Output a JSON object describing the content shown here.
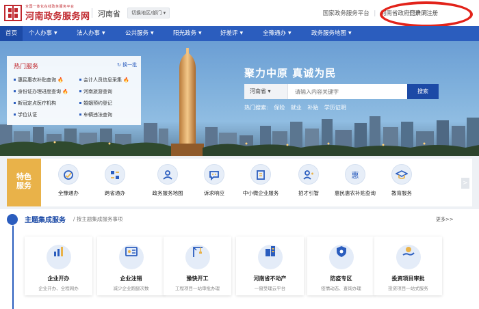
{
  "header": {
    "logo_small": "全国一体化在线政务服务平台",
    "logo_name": "河南政务服务网",
    "province": "河南省",
    "switch_label": "切换地区/部门 ▾",
    "links": [
      "国家政务服务平台",
      "河南省政府门户网"
    ],
    "login": "登录 / 注册"
  },
  "nav": {
    "items": [
      "首页",
      "个人办事",
      "法人办事",
      "公共服务",
      "阳光政务",
      "好差评",
      "全豫通办",
      "政务服务地图"
    ]
  },
  "hot_services": {
    "title": "热门服务",
    "refresh": "↻ 换一批",
    "items": [
      "惠民惠农补贴查询",
      "会计人员信息采集",
      "身份证办理进度查询",
      "河南旅游查询",
      "新冠定点医疗机构",
      "婚姻预约登记",
      "学位认证",
      "车辆违法查询"
    ]
  },
  "hero": {
    "slogan": "聚力中原  真诚为民",
    "search_province": "河南省 ▾",
    "search_placeholder": "请输入内容关键字",
    "search_button": "搜索",
    "hot_search_label": "热门搜索:",
    "hot_keywords": [
      "保险",
      "就业",
      "补贴",
      "学历证明"
    ]
  },
  "featured": {
    "tag_line1": "特色",
    "tag_line2": "服务",
    "items": [
      "全豫通办",
      "跨省通办",
      "政务服务地图",
      "诉求响应",
      "中小微企业服务",
      "招才引智",
      "惠民惠农补贴查询",
      "教育服务"
    ]
  },
  "theme": {
    "title": "主题集成服务",
    "subtitle": "/ 按主题集成服务事项",
    "more": "更多>>",
    "cards": [
      {
        "name": "企业开办",
        "desc": "企业开办、全程网办"
      },
      {
        "name": "企业注销",
        "desc": "减少企业跑腿次数"
      },
      {
        "name": "豫快开工",
        "desc": "工程项目一站审批办理"
      },
      {
        "name": "河南省不动产",
        "desc": "一窗受理云平台"
      },
      {
        "name": "防疫专区",
        "desc": "疫情动态、查询办理"
      },
      {
        "name": "投资项目审批",
        "desc": "投资项目一站式服务"
      }
    ]
  },
  "colors": {
    "brand_red": "#c0272d",
    "nav_blue": "#2b5dbe",
    "feature_gold": "#e9b249",
    "highlight_oval": "#e2231a"
  }
}
